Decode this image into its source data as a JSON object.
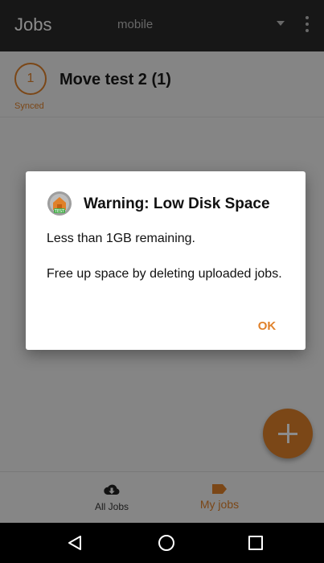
{
  "app": {
    "title": "Jobs",
    "account": "mobile"
  },
  "job": {
    "counter": "1",
    "title": "Move test 2 (1)",
    "status": "Synced"
  },
  "dialog": {
    "title": "Warning: Low Disk Space",
    "line1": "Less than 1GB remaining.",
    "line2": "Free up space by deleting uploaded jobs.",
    "ok_label": "OK",
    "icon": "app-logo-test-icon"
  },
  "fab": {
    "icon": "plus-icon"
  },
  "bottom_nav": {
    "items": [
      {
        "label": "All Jobs",
        "icon": "cloud-download-icon"
      },
      {
        "label": "My jobs",
        "icon": "label-tag-icon"
      }
    ]
  },
  "system_nav": {
    "buttons": [
      "back-icon",
      "home-icon",
      "recents-icon"
    ]
  },
  "colors": {
    "accent": "#e0812a",
    "appbar": "#2a2a2a",
    "scrim": "rgba(0,0,0,0.45)"
  }
}
